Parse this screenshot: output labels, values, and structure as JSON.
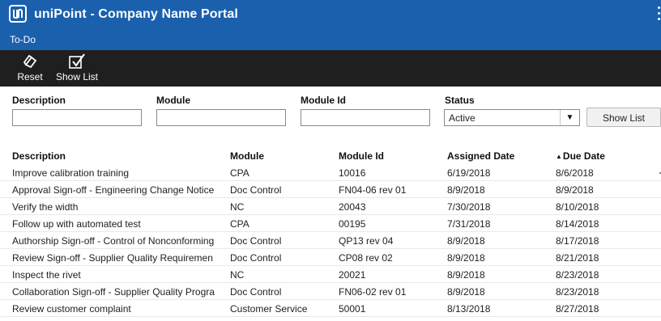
{
  "app": {
    "title": "uniPoint - Company Name Portal",
    "logo_icon": "unipoint-logo",
    "menu_icon": "kebab-menu-icon"
  },
  "tabs": [
    {
      "label": "To-Do",
      "active": true
    }
  ],
  "toolbar": {
    "reset_label": "Reset",
    "reset_icon": "eraser-icon",
    "show_list_label": "Show List",
    "show_list_icon": "checkbox-check-icon"
  },
  "filters": {
    "description_label": "Description",
    "description_value": "",
    "module_label": "Module",
    "module_value": "",
    "module_id_label": "Module Id",
    "module_id_value": "",
    "status_label": "Status",
    "status_value": "Active",
    "show_list_button": "Show List"
  },
  "table": {
    "columns": [
      "Description",
      "Module",
      "Module Id",
      "Assigned Date",
      "Due Date"
    ],
    "sort_column": "Due Date",
    "sort_direction": "ascending",
    "rows": [
      [
        "Improve calibration training",
        "CPA",
        "10016",
        "6/19/2018",
        "8/6/2018"
      ],
      [
        "Approval Sign-off - Engineering Change Notice",
        "Doc Control",
        "FN04-06 rev 01",
        "8/9/2018",
        "8/9/2018"
      ],
      [
        "Verify the width",
        "NC",
        "20043",
        "7/30/2018",
        "8/10/2018"
      ],
      [
        "Follow up with automated test",
        "CPA",
        "00195",
        "7/31/2018",
        "8/14/2018"
      ],
      [
        "Authorship Sign-off - Control of Nonconforming",
        "Doc Control",
        "QP13 rev 04",
        "8/9/2018",
        "8/17/2018"
      ],
      [
        "Review Sign-off - Supplier Quality Requiremen",
        "Doc Control",
        "CP08 rev 02",
        "8/9/2018",
        "8/21/2018"
      ],
      [
        "Inspect the rivet",
        "NC",
        "20021",
        "8/9/2018",
        "8/23/2018"
      ],
      [
        "Collaboration Sign-off - Supplier Quality Progra",
        "Doc Control",
        "FN06-02 rev 01",
        "8/9/2018",
        "8/23/2018"
      ],
      [
        "Review customer complaint",
        "Customer Service",
        "50001",
        "8/13/2018",
        "8/27/2018"
      ]
    ]
  },
  "colors": {
    "header_blue": "#1b60ad",
    "toolbar_dark": "#1f1f1f"
  }
}
